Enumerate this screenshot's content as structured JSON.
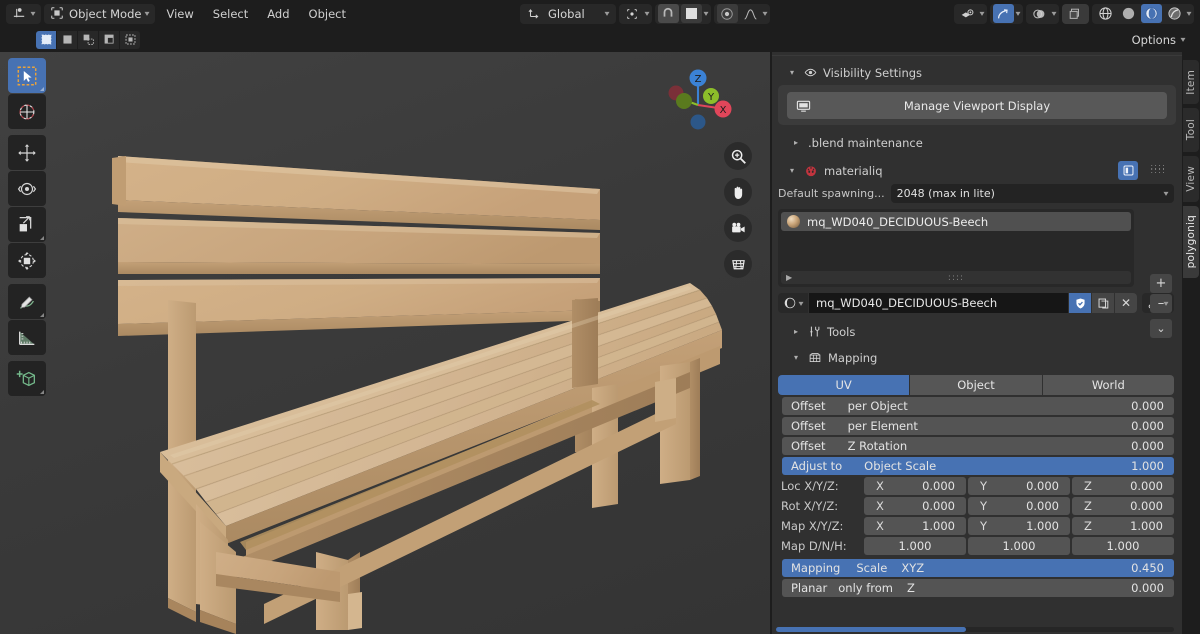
{
  "topbar": {
    "editor_type_icon": "editor-type-icon",
    "mode_icon": "object-mode-icon",
    "mode_label": "Object Mode",
    "menus": [
      "View",
      "Select",
      "Add",
      "Object"
    ],
    "transform_orientation_label": "Global",
    "transform_orientation_icon": "orientation-axes-icon",
    "pivot_icon": "pivot-point-icon",
    "snap_icon": "snap-magnet-icon",
    "snap_target_icon": "snap-target-icon",
    "proportional_icon": "proportional-edit-icon",
    "falloff_icon": "proportional-falloff-icon",
    "visibility_icon": "object-visibility-icon",
    "gizmo_icon": "gizmo-icon",
    "overlays_icon": "overlays-icon",
    "xray_icon": "xray-toggle-icon",
    "shading": [
      {
        "name": "wireframe-shading-icon",
        "active": false
      },
      {
        "name": "solid-shading-icon",
        "active": false
      },
      {
        "name": "material-preview-shading-icon",
        "active": true
      },
      {
        "name": "rendered-shading-icon",
        "active": false
      }
    ]
  },
  "toolrow": {
    "select_modes": [
      "select-box-icon",
      "select-set-icon",
      "select-extend-icon",
      "select-subtract-icon",
      "select-invert-icon"
    ]
  },
  "properties_header": {
    "options_label": "Options",
    "options_icon": "chevron-down-icon"
  },
  "left_toolbar": {
    "tools": [
      {
        "name": "tool-tweak-select-box",
        "active": true
      },
      {
        "name": "tool-cursor",
        "active": false
      },
      {
        "name": "tool-move",
        "active": false
      },
      {
        "name": "tool-rotate",
        "active": false
      },
      {
        "name": "tool-scale",
        "active": false
      },
      {
        "name": "tool-transform",
        "active": false
      },
      {
        "name": "tool-annotate",
        "active": false
      },
      {
        "name": "tool-measure",
        "active": false
      },
      {
        "name": "tool-add-cube",
        "active": false
      }
    ]
  },
  "viewport": {
    "gizmo": {
      "axes": [
        {
          "label": "Z",
          "color": "#3b82d6"
        },
        {
          "label": "Y",
          "color": "#8cbe2a"
        },
        {
          "label": "X",
          "color": "#e0465a"
        }
      ],
      "neg_colors": [
        "#7a3038",
        "#5a7a1e",
        "#2c5788"
      ]
    },
    "nav_buttons": [
      "zoom-icon",
      "pan-hand-icon",
      "camera-view-icon",
      "toggle-perspective-icon"
    ],
    "object": "wooden-bench"
  },
  "sidebar_tabs": [
    {
      "label": "Item",
      "selected": false
    },
    {
      "label": "Tool",
      "selected": false
    },
    {
      "label": "View",
      "selected": false
    },
    {
      "label": "polygoniq",
      "selected": true
    }
  ],
  "panel": {
    "visibility_settings": {
      "label": "Visibility Settings",
      "icon": "eye-icon",
      "expanded": true,
      "manage_button": {
        "label": "Manage Viewport Display",
        "icon": "monitor-icon"
      }
    },
    "blend_maintenance": {
      "label": ".blend maintenance",
      "expanded": false
    },
    "materialiq": {
      "label": "materialiq",
      "icon": "materialiq-logo-icon",
      "expanded": true,
      "pin_icon": "panel-pin-icon",
      "grip_icon": "drag-grip-icon",
      "spawn_row": {
        "label": "Default spawning...",
        "value": "2048 (max in lite)",
        "chevron": "chevron-down-icon"
      },
      "material_list": {
        "items": [
          {
            "name": "mq_WD040_DECIDUOUS-Beech",
            "selected": true
          }
        ],
        "buttons": [
          "add-material-button",
          "remove-material-button",
          "material-specials-button"
        ],
        "button_glyphs": [
          "+",
          "–",
          "⌄"
        ],
        "expand_arrow": "expand-arrow-icon",
        "grip": "::::"
      },
      "material_field": {
        "browse_icon": "browse-material-icon",
        "name": "mq_WD040_DECIDUOUS-Beech",
        "shield_icon": "fake-user-shield-icon",
        "copy_icon": "new-material-copy-icon",
        "close_icon": "unlink-material-icon",
        "node_icon": "material-nodes-icon"
      },
      "tools_section": {
        "label": "Tools",
        "icon": "tools-wrench-icon",
        "expanded": false
      },
      "mapping_section": {
        "label": "Mapping",
        "icon": "mapping-grid-icon",
        "expanded": true,
        "modes": [
          {
            "label": "UV",
            "selected": true
          },
          {
            "label": "Object",
            "selected": false
          },
          {
            "label": "World",
            "selected": false
          }
        ],
        "rows": [
          {
            "label": "Offset",
            "sub": "per Object",
            "value": "0.000",
            "selected": false
          },
          {
            "label": "Offset",
            "sub": "per Element",
            "value": "0.000",
            "selected": false
          },
          {
            "label": "Offset",
            "sub": "Z Rotation",
            "value": "0.000",
            "selected": false
          },
          {
            "label": "Adjust  to",
            "sub": "Object  Scale",
            "value": "1.000",
            "selected": true
          }
        ],
        "vector_rows": [
          {
            "label": "Loc X/Y/Z:",
            "axes": [
              "X",
              "Y",
              "Z"
            ],
            "values": [
              "0.000",
              "0.000",
              "0.000"
            ]
          },
          {
            "label": "Rot X/Y/Z:",
            "axes": [
              "X",
              "Y",
              "Z"
            ],
            "values": [
              "0.000",
              "0.000",
              "0.000"
            ]
          },
          {
            "label": "Map X/Y/Z:",
            "axes": [
              "X",
              "Y",
              "Z"
            ],
            "values": [
              "1.000",
              "1.000",
              "1.000"
            ]
          },
          {
            "label": "Map D/N/H:",
            "axes": [
              "",
              "",
              ""
            ],
            "values": [
              "1.000",
              "1.000",
              "1.000"
            ]
          }
        ],
        "bottom_rows": [
          {
            "label": "Mapping",
            "sub": "Scale",
            "sub2": "XYZ",
            "value": "0.450",
            "selected": true
          },
          {
            "label": "Planar",
            "sub": "only  from",
            "sub2": "Z",
            "value": "0.000",
            "selected": false
          }
        ]
      }
    }
  },
  "colors": {
    "accent_blue": "#4772b3",
    "panel_bg": "#303030",
    "viewport_bg": "#3b3b3b",
    "header_bg": "#1d1d1d",
    "wood": "#c9a576"
  }
}
